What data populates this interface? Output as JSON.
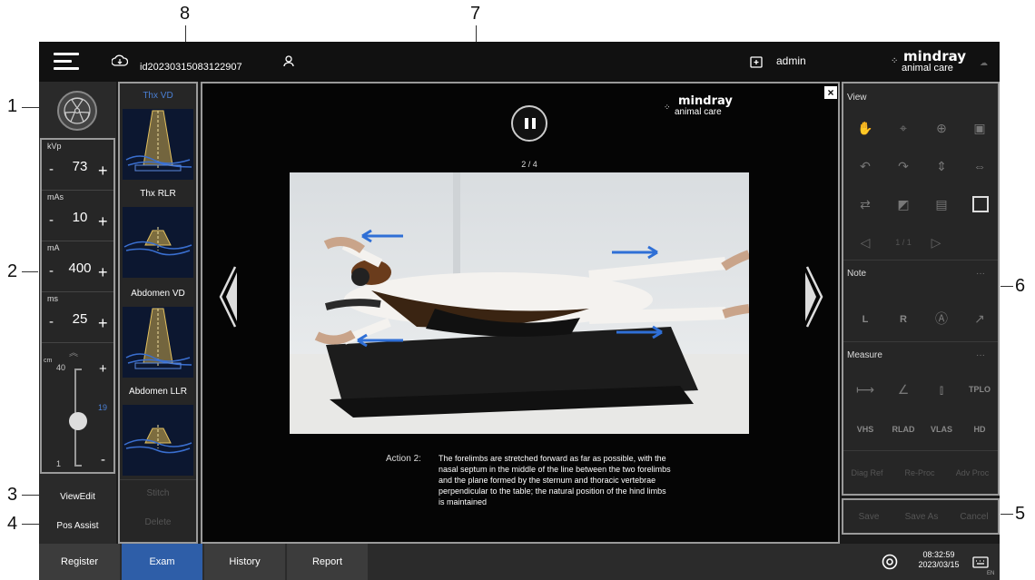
{
  "callouts": {
    "n1": "1",
    "n2": "2",
    "n3": "3",
    "n4": "4",
    "n5": "5",
    "n6": "6",
    "n7": "7",
    "n8": "8"
  },
  "topbar": {
    "patient_id": "id20230315083122907",
    "user": "admin",
    "brand_main": "mindray",
    "brand_sub": "animal care"
  },
  "exposure": {
    "kvp": {
      "label": "kVp",
      "value": "73"
    },
    "mas": {
      "label": "mAs",
      "value": "10"
    },
    "ma": {
      "label": "mA",
      "value": "400"
    },
    "ms": {
      "label": "ms",
      "value": "25"
    },
    "minus": "-",
    "plus": "+"
  },
  "thickness": {
    "unit": "cm",
    "max": "40",
    "min": "1",
    "current": "19",
    "plus": "+",
    "minus": "-",
    "level": 0.46
  },
  "left_buttons": {
    "view_edit": "ViewEdit",
    "pos_assist": "Pos Assist"
  },
  "protocols": [
    {
      "label": "Thx VD",
      "selected": true
    },
    {
      "label": "Thx RLR",
      "selected": false
    },
    {
      "label": "Abdomen VD",
      "selected": false
    },
    {
      "label": "Abdomen LLR",
      "selected": false
    }
  ],
  "thumb_actions": {
    "stitch": "Stitch",
    "delete": "Delete"
  },
  "guide": {
    "page": "2 / 4",
    "brand_main": "mindray",
    "brand_sub": "animal care",
    "action_label": "Action 2:",
    "action_lines": [
      "The forelimbs are stretched forward as far as possible, with the",
      "nasal septum in the middle of the line between the two forelimbs",
      "and the plane formed by the sternum and thoracic vertebrae",
      "perpendicular to the table; the natural position of the hind limbs",
      "is maintained"
    ]
  },
  "right_panel": {
    "view_title": "View",
    "view_page": "1 / 1",
    "note_title": "Note",
    "note_l": "L",
    "note_r": "R",
    "measure_title": "Measure",
    "tplo": "TPLO",
    "vhs": "VHS",
    "rlad": "RLAD",
    "vlas": "VLAS",
    "hd": "HD",
    "diag_ref": "Diag Ref",
    "re_proc": "Re-Proc",
    "adv_proc": "Adv Proc",
    "more": "···"
  },
  "save_bar": {
    "save": "Save",
    "save_as": "Save As",
    "cancel": "Cancel"
  },
  "tabs": {
    "register": "Register",
    "exam": "Exam",
    "history": "History",
    "report": "Report"
  },
  "status": {
    "time": "08:32:59",
    "date": "2023/03/15",
    "lang": "EN"
  },
  "colors": {
    "accent": "#2e5ea8",
    "selected_text": "#4a7fd4",
    "panel_border": "#9a9a9a"
  }
}
